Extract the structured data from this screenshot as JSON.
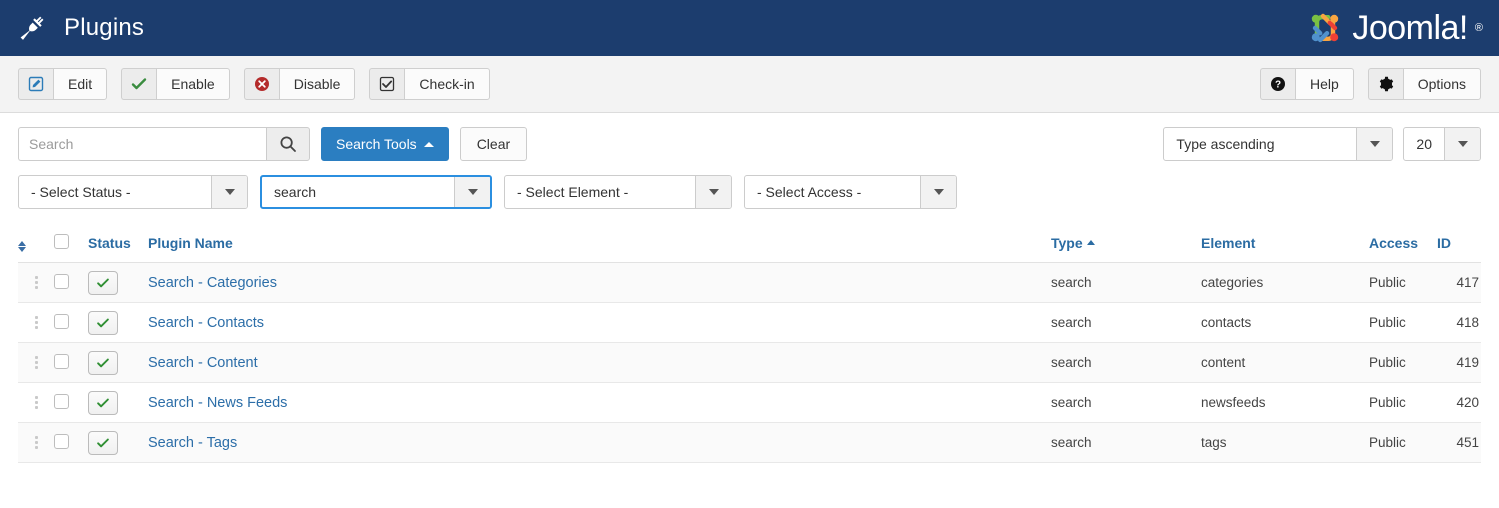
{
  "header": {
    "title": "Plugins",
    "icon": "plug-icon",
    "brand": "Joomla!",
    "brand_mark": "®",
    "bg_color": "#1c3d6e"
  },
  "toolbar": {
    "left_buttons": [
      {
        "label": "Edit",
        "icon": "edit-pencil-square-icon"
      },
      {
        "label": "Enable",
        "icon": "check-icon"
      },
      {
        "label": "Disable",
        "icon": "times-circle-icon"
      },
      {
        "label": "Check-in",
        "icon": "checkbox-checked-icon"
      }
    ],
    "right_buttons": [
      {
        "label": "Help",
        "icon": "question-circle-icon"
      },
      {
        "label": "Options",
        "icon": "gear-icon"
      }
    ]
  },
  "filters": {
    "search_placeholder": "Search",
    "search_value": "",
    "search_icon": "search-icon",
    "search_tools_label": "Search Tools",
    "clear_label": "Clear",
    "sort_value": "Type ascending",
    "limit_value": "20",
    "status_value": "- Select Status -",
    "type_value": "search",
    "element_value": "- Select Element -",
    "access_value": "- Select Access -",
    "focus_color": "#2b8fe0",
    "primary_color": "#2b7ec1"
  },
  "table": {
    "headers": {
      "handle": "",
      "check": "",
      "status": "Status",
      "name": "Plugin Name",
      "type": "Type",
      "element": "Element",
      "access": "Access",
      "id": "ID"
    },
    "sorted_column": "Type",
    "sort_direction": "ascending",
    "rows": [
      {
        "name": "Search - Categories",
        "type": "search",
        "element": "categories",
        "access": "Public",
        "id": "417",
        "status": "enabled"
      },
      {
        "name": "Search - Contacts",
        "type": "search",
        "element": "contacts",
        "access": "Public",
        "id": "418",
        "status": "enabled"
      },
      {
        "name": "Search - Content",
        "type": "search",
        "element": "content",
        "access": "Public",
        "id": "419",
        "status": "enabled"
      },
      {
        "name": "Search - News Feeds",
        "type": "search",
        "element": "newsfeeds",
        "access": "Public",
        "id": "420",
        "status": "enabled"
      },
      {
        "name": "Search - Tags",
        "type": "search",
        "element": "tags",
        "access": "Public",
        "id": "451",
        "status": "enabled"
      }
    ]
  }
}
